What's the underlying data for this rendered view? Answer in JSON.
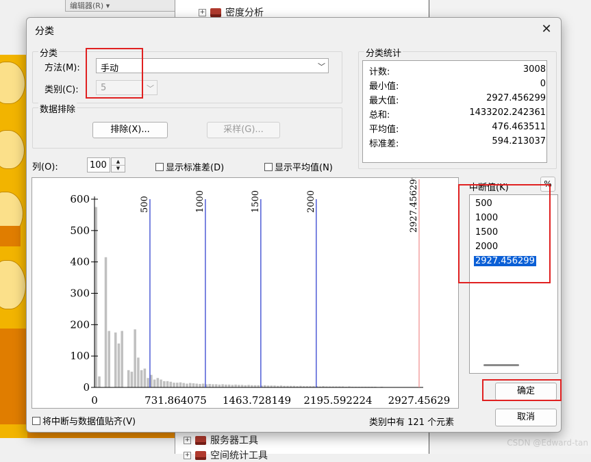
{
  "background": {
    "toolbar_label": "编辑器(R) ▾",
    "tree_items": [
      {
        "label": "密度分析"
      },
      {
        "label": "服务器工具"
      },
      {
        "label": "空间统计工具"
      }
    ],
    "watermark": "CSDN @Edward-tan",
    "colors": {
      "map_fill": "#f2b400",
      "map_dark": "#e07d00"
    }
  },
  "dialog": {
    "title": "分类",
    "close_glyph": "✕",
    "classification": {
      "group_title": "分类",
      "method_label": "方法(M):",
      "method_value": "手动",
      "classes_label": "类别(C):",
      "classes_value": "5"
    },
    "exclusion": {
      "group_title": "数据排除",
      "exclude_button": "排除(X)...",
      "sample_button": "采样(G)..."
    },
    "statistics": {
      "group_title": "分类统计",
      "rows": [
        {
          "key": "计数:",
          "value": "3008"
        },
        {
          "key": "最小值:",
          "value": "0"
        },
        {
          "key": "最大值:",
          "value": "2927.456299"
        },
        {
          "key": "总和:",
          "value": "1433202.242361"
        },
        {
          "key": "平均值:",
          "value": "476.463511"
        },
        {
          "key": "标准差:",
          "value": "594.213037"
        }
      ]
    },
    "columns_label": "列(O):",
    "columns_value": "100",
    "show_std_label": "显示标准差(D)",
    "show_mean_label": "显示平均值(N)",
    "breaks_label": "中断值(K)",
    "percent_button": "%",
    "break_values": [
      "500",
      "1000",
      "1500",
      "2000",
      "2927.456299"
    ],
    "snap_label": "将中断与数据值贴齐(V)",
    "class_count_text": "类别中有 121 个元素",
    "ok_button": "确定",
    "cancel_button": "取消"
  },
  "chart_data": {
    "type": "bar",
    "title": "",
    "xlabel": "",
    "ylabel": "",
    "xlim": [
      0,
      2927.456299
    ],
    "ylim": [
      0,
      600
    ],
    "y_ticks": [
      0,
      100,
      200,
      300,
      400,
      500,
      600
    ],
    "x_tick_labels": [
      "0",
      "731.864075",
      "1463.728149",
      "2195.592224",
      "2927.45629"
    ],
    "x_ticks": [
      0,
      731.864075,
      1463.728149,
      2195.592224,
      2927.456299
    ],
    "bin_width": 29.27456299,
    "histogram_counts": [
      575,
      35,
      0,
      415,
      180,
      0,
      175,
      140,
      180,
      0,
      55,
      50,
      185,
      95,
      55,
      60,
      30,
      40,
      25,
      30,
      25,
      20,
      20,
      18,
      15,
      15,
      16,
      14,
      12,
      14,
      13,
      12,
      11,
      12,
      10,
      11,
      10,
      10,
      9,
      10,
      9,
      9,
      8,
      9,
      8,
      8,
      7,
      8,
      7,
      7,
      7,
      6,
      7,
      6,
      6,
      6,
      5,
      6,
      5,
      5,
      5,
      5,
      4,
      5,
      4,
      4,
      4,
      4,
      4,
      3,
      4,
      3,
      3,
      3,
      3,
      3,
      3,
      2,
      3,
      2,
      2,
      2,
      2,
      2,
      2,
      2,
      2,
      1,
      2,
      1,
      1,
      1,
      1,
      1,
      1,
      1,
      1,
      1,
      1,
      1
    ],
    "breaks": [
      {
        "value": 500,
        "label": "500"
      },
      {
        "value": 1000,
        "label": "1000"
      },
      {
        "value": 1500,
        "label": "1500"
      },
      {
        "value": 2000,
        "label": "2000"
      },
      {
        "value": 2927.456299,
        "label": "2927.456299"
      }
    ],
    "colors": {
      "bars": "#c0c0c0",
      "break_line": "#2233cc",
      "max_line": "#f08a8a",
      "axis": "#000000"
    }
  }
}
